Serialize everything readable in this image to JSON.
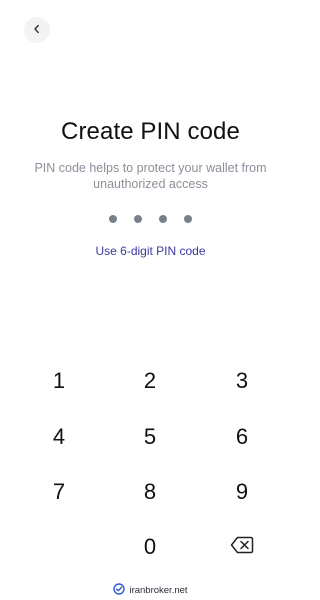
{
  "header": {
    "back_icon": "chevron-left-icon"
  },
  "main": {
    "title": "Create PIN code",
    "subtitle": "PIN code helps to protect your wallet from unauthorized access",
    "pin_length": 4,
    "pin_entered": 0,
    "alt_link": "Use 6-digit PIN code"
  },
  "keypad": {
    "keys": [
      "1",
      "2",
      "3",
      "4",
      "5",
      "6",
      "7",
      "8",
      "9",
      "",
      "0"
    ],
    "backspace_icon": "backspace-icon"
  },
  "footer": {
    "brand": "iranbroker.net",
    "logo_icon": "check-badge-icon"
  },
  "colors": {
    "accent": "#3b3aa0",
    "text": "#111111",
    "muted": "#8a8f99",
    "dot": "#7a808b",
    "back_bg": "#f2f3f5"
  }
}
